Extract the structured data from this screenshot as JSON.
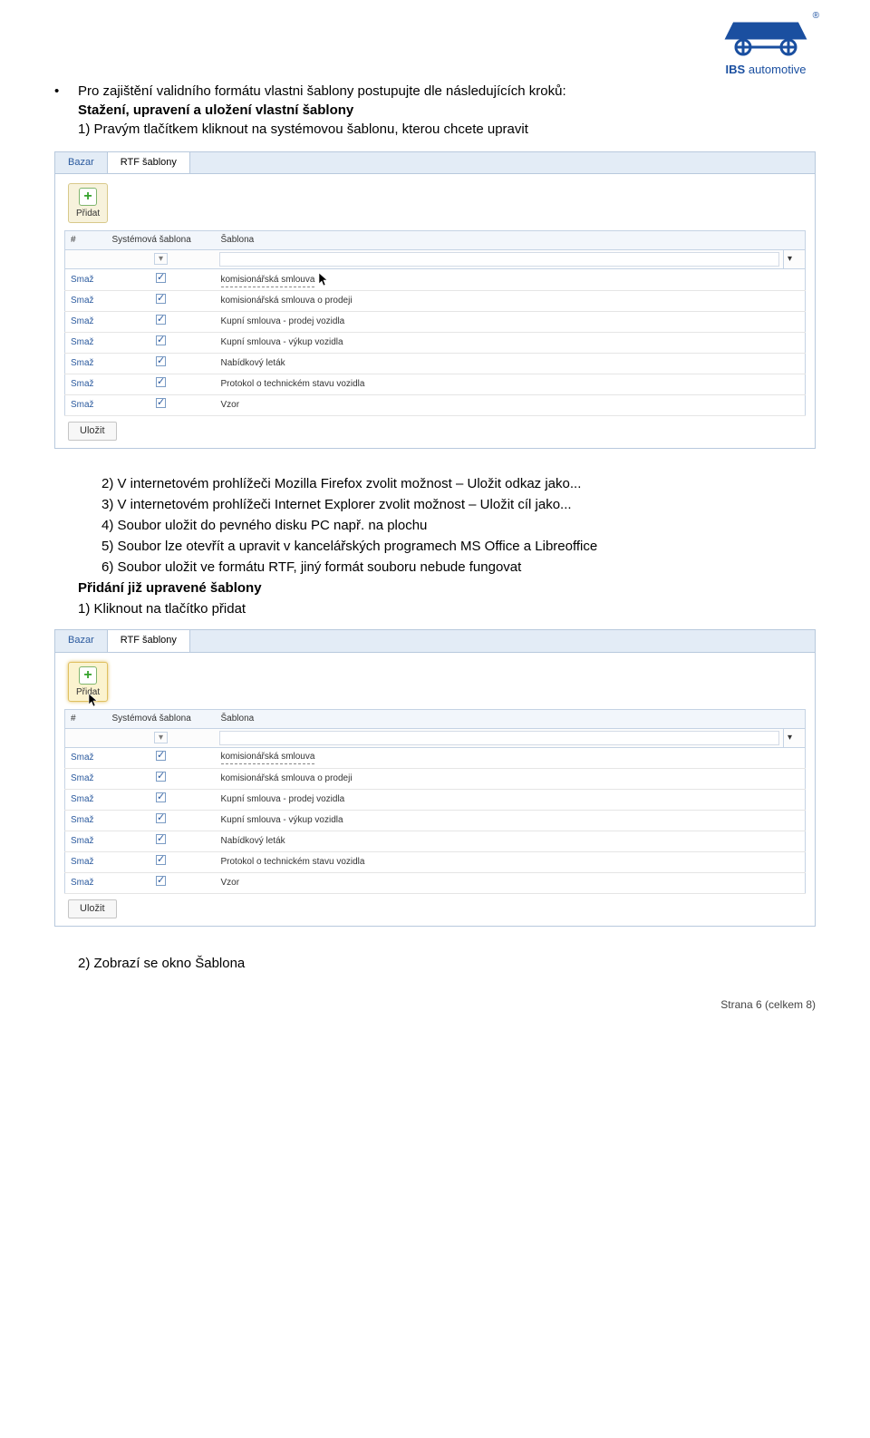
{
  "logo": {
    "brand": "IBS",
    "sub": "automotive",
    "reg": "®"
  },
  "intro": {
    "line1": "Pro zajištění validního formátu vlastni  šablony postupujte dle následujících kroků:",
    "heading": "Stažení, upravení a uložení vlastní  šablony",
    "step1": "1)  Pravým tlačítkem kliknout na systémovou šablonu, kterou chcete upravit"
  },
  "steps2": {
    "s2": "2)  V internetovém prohlížeči Mozilla Firefox zvolit možnost – Uložit odkaz jako...",
    "s3": "3)  V internetovém prohlížeči Internet Explorer zvolit možnost – Uložit cíl jako...",
    "s4": "4)  Soubor uložit do pevného disku PC např. na plochu",
    "s5": "5)  Soubor lze otevřít a upravit v kancelářských programech MS Office a Libreoffice",
    "s6": "6)  Soubor uložit ve formátu RTF, jiný formát souboru nebude fungovat"
  },
  "section2": {
    "heading": "Přidání již upravené šablony",
    "step1": "1)  Kliknout na tlačítko přidat"
  },
  "last": "2)  Zobrazí se okno Šablona",
  "shot": {
    "tab1": "Bazar",
    "tab2": "RTF šablony",
    "addLabel": "Přidat",
    "col_del": "#",
    "col_sys": "Systémová šablona",
    "col_name": "Šablona",
    "del": "Smaž",
    "save": "Uložit",
    "rows1": [
      {
        "name": "komisionářská smlouva",
        "dotted": true
      },
      {
        "name": "komisionářská smlouva o prodeji"
      },
      {
        "name": "Kupní smlouva - prodej vozidla"
      },
      {
        "name": "Kupní smlouva - výkup vozidla"
      },
      {
        "name": "Nabídkový leták"
      },
      {
        "name": "Protokol o technickém stavu vozidla"
      },
      {
        "name": "Vzor"
      }
    ],
    "rows2": [
      {
        "name": "komisionářská smlouva",
        "dotted": true
      },
      {
        "name": "komisionářská smlouva o prodeji"
      },
      {
        "name": "Kupní smlouva - prodej vozidla"
      },
      {
        "name": "Kupní smlouva - výkup vozidla"
      },
      {
        "name": "Nabídkový leták"
      },
      {
        "name": "Protokol o technickém stavu vozidla"
      },
      {
        "name": "Vzor"
      }
    ]
  },
  "footer": "Strana 6 (celkem 8)"
}
